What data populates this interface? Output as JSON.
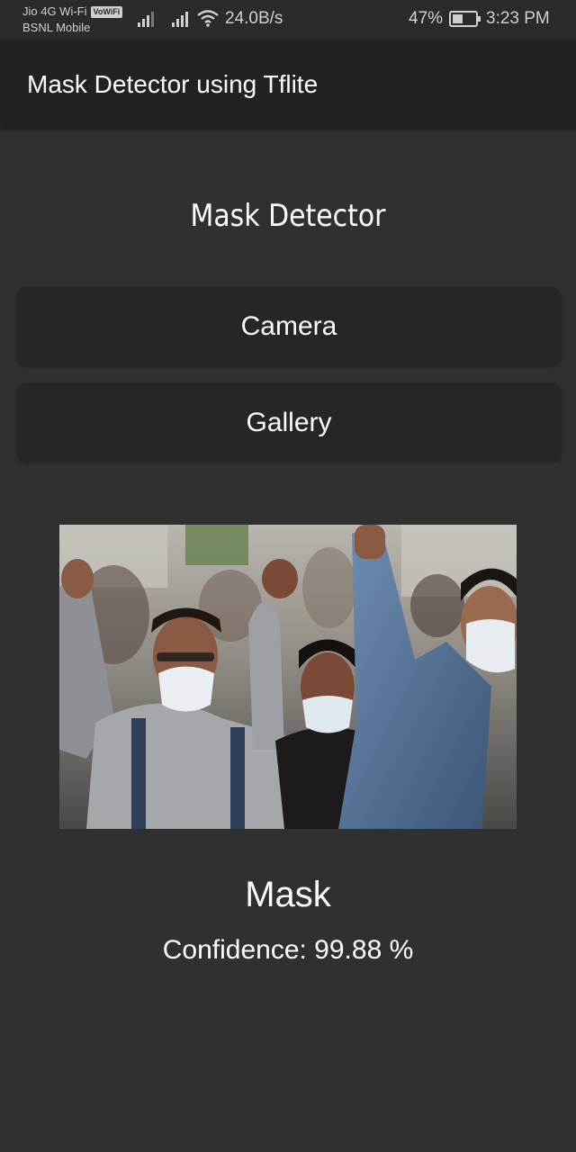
{
  "status_bar": {
    "carrier_line1": "Jio 4G Wi-Fi",
    "vowifi_badge": "VoWiFi",
    "carrier_line2": "BSNL Mobile",
    "net_speed": "24.0B/s",
    "battery_percent": "47%",
    "battery_level": 0.47,
    "time": "3:23 PM",
    "icons": [
      "signal-icon",
      "signal-icon",
      "wifi-icon",
      "battery-icon"
    ]
  },
  "app_bar": {
    "title": "Mask Detector using Tflite"
  },
  "main": {
    "heading": "Mask Detector",
    "camera_button": "Camera",
    "gallery_button": "Gallery",
    "result_label": "Mask",
    "confidence_text": "Confidence: 99.88 %"
  },
  "colors": {
    "background": "#303030",
    "app_bar": "#222222",
    "button": "#262626",
    "text": "#ffffff"
  }
}
